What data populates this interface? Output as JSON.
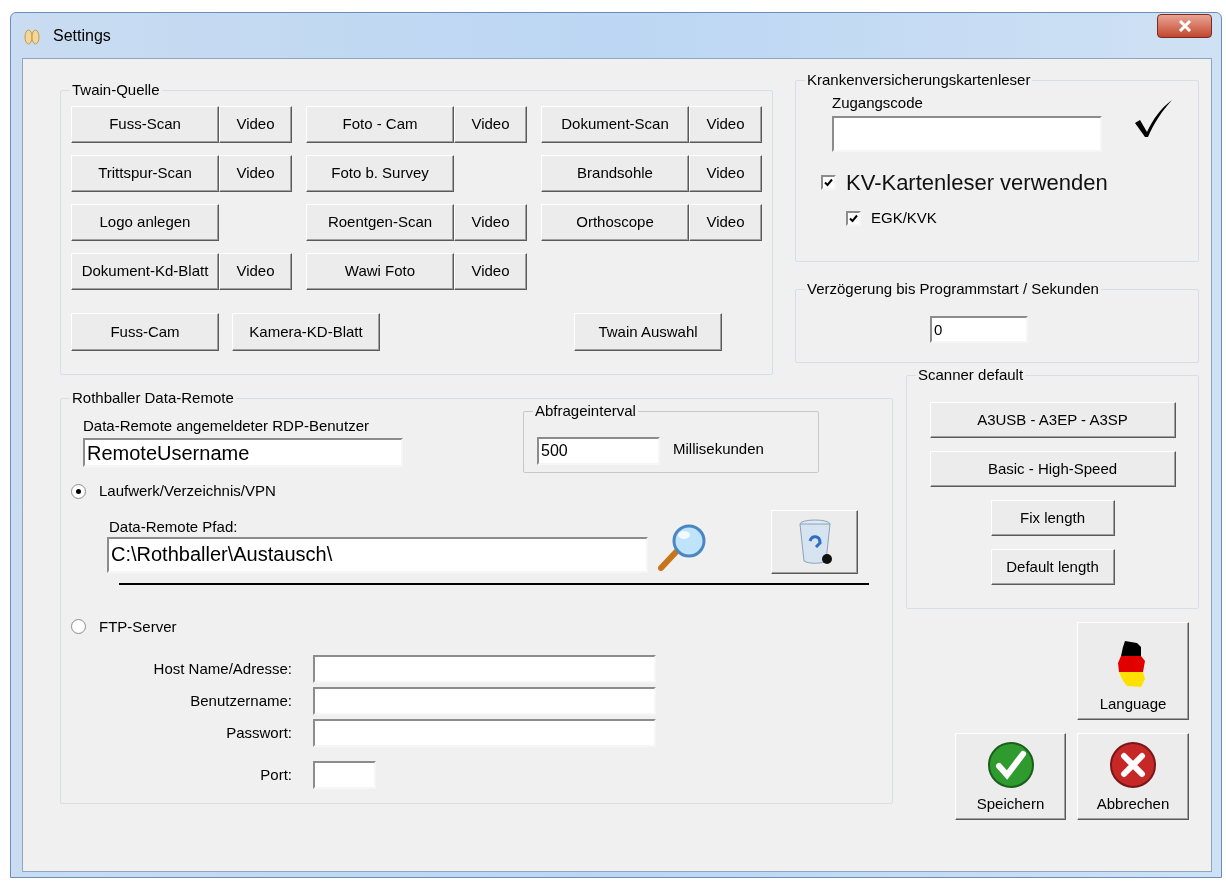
{
  "window": {
    "title": "Settings"
  },
  "twain": {
    "title": "Twain-Quelle",
    "columns": [
      [
        {
          "label": "Fuss-Scan",
          "video": "Video"
        },
        {
          "label": "Trittspur-Scan",
          "video": "Video"
        },
        {
          "label": "Logo anlegen"
        },
        {
          "label": "Dokument-Kd-Blatt",
          "video": "Video"
        }
      ],
      [
        {
          "label": "Foto - Cam",
          "video": "Video"
        },
        {
          "label": "Foto b. Survey"
        },
        {
          "label": "Roentgen-Scan",
          "video": "Video"
        },
        {
          "label": "Wawi Foto",
          "video": "Video"
        }
      ],
      [
        {
          "label": "Dokument-Scan",
          "video": "Video"
        },
        {
          "label": "Brandsohle",
          "video": "Video"
        },
        {
          "label": "Orthoscope",
          "video": "Video"
        }
      ]
    ],
    "bottom_buttons": [
      "Fuss-Cam",
      "Kamera-KD-Blatt",
      "Twain Auswahl"
    ]
  },
  "card_reader": {
    "title": "Krankenversicherungskartenleser",
    "access_code_label": "Zugangscode",
    "code_valid": true,
    "options": [
      {
        "label": "KV-Kartenleser verwenden",
        "checked": true,
        "kind": "main"
      },
      {
        "label": "EGK/KVK",
        "checked": true,
        "kind": "sub"
      }
    ]
  },
  "delay": {
    "title": "Verzögerung bis Programmstart / Sekunden",
    "value": "0"
  },
  "scanner_default": {
    "title": "Scanner default",
    "buttons": [
      {
        "label": "A3USB - A3EP - A3SP",
        "kind": "wide"
      },
      {
        "label": "Basic - High-Speed",
        "kind": "wide"
      },
      {
        "label": "Fix length",
        "kind": "narrow"
      },
      {
        "label": "Default length",
        "kind": "narrow"
      }
    ]
  },
  "data_remote": {
    "title": "Rothballer Data-Remote",
    "rdp_label": "Data-Remote angemeldeter RDP-Benutzer",
    "rdp_value": "RemoteUsername",
    "interval": {
      "title": "Abfrageinterval",
      "value": "500",
      "unit": "Millisekunden"
    },
    "modes": [
      {
        "label": "Laufwerk/Verzeichnis/VPN",
        "selected": true
      },
      {
        "label": "FTP-Server",
        "selected": false
      }
    ],
    "path_label": "Data-Remote Pfad:",
    "path_value": "C:\\Rothballer\\Austausch\\",
    "ftp_fields": [
      {
        "label": "Host Name/Adresse:",
        "kind": "long"
      },
      {
        "label": "Benutzername:",
        "kind": "long"
      },
      {
        "label": "Passwort:",
        "kind": "long"
      },
      {
        "label": "Port:",
        "kind": "short"
      }
    ]
  },
  "actions": [
    {
      "label": "Language",
      "kind": "language"
    },
    {
      "label": "Speichern",
      "kind": "save"
    },
    {
      "label": "Abbrechen",
      "kind": "cancel"
    }
  ]
}
